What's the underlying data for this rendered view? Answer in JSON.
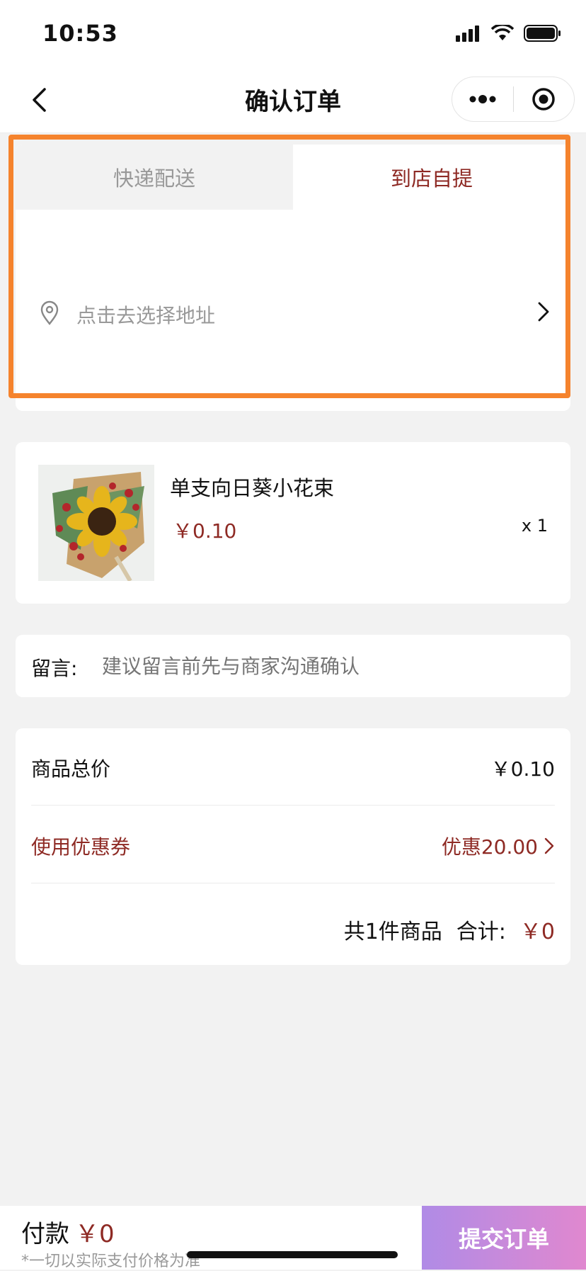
{
  "status_bar": {
    "time": "10:53"
  },
  "nav": {
    "title": "确认订单",
    "back_icon": "chevron-left-icon",
    "more_icon": "more-dots-icon",
    "target_icon": "target-circle-icon"
  },
  "delivery": {
    "tabs": [
      {
        "label": "快递配送",
        "active": false
      },
      {
        "label": "到店自提",
        "active": true
      }
    ],
    "address_placeholder": "点击去选择地址",
    "pin_icon": "location-pin-icon",
    "arrow_icon": "chevron-right-icon"
  },
  "product": {
    "name": "单支向日葵小花束",
    "price": "￥0.10",
    "quantity": "x 1",
    "image_icon": "sunflower-bouquet-image"
  },
  "message": {
    "label": "留言:",
    "placeholder": "建议留言前先与商家沟通确认"
  },
  "summary": {
    "goods_total_label": "商品总价",
    "goods_total_value": "￥0.10",
    "coupon_label": "使用优惠券",
    "coupon_value": "优惠20.00",
    "count_text": "共1件商品",
    "total_label": "合计:",
    "total_value": "￥0"
  },
  "footer": {
    "pay_label": "付款",
    "pay_amount": "￥0",
    "pay_note": "*一切以实际支付价格为准",
    "submit_label": "提交订单"
  },
  "colors": {
    "accent_red": "#8e2a24",
    "highlight_orange": "#f5832d",
    "submit_gradient_start": "#b08be6",
    "submit_gradient_end": "#e088cf"
  }
}
